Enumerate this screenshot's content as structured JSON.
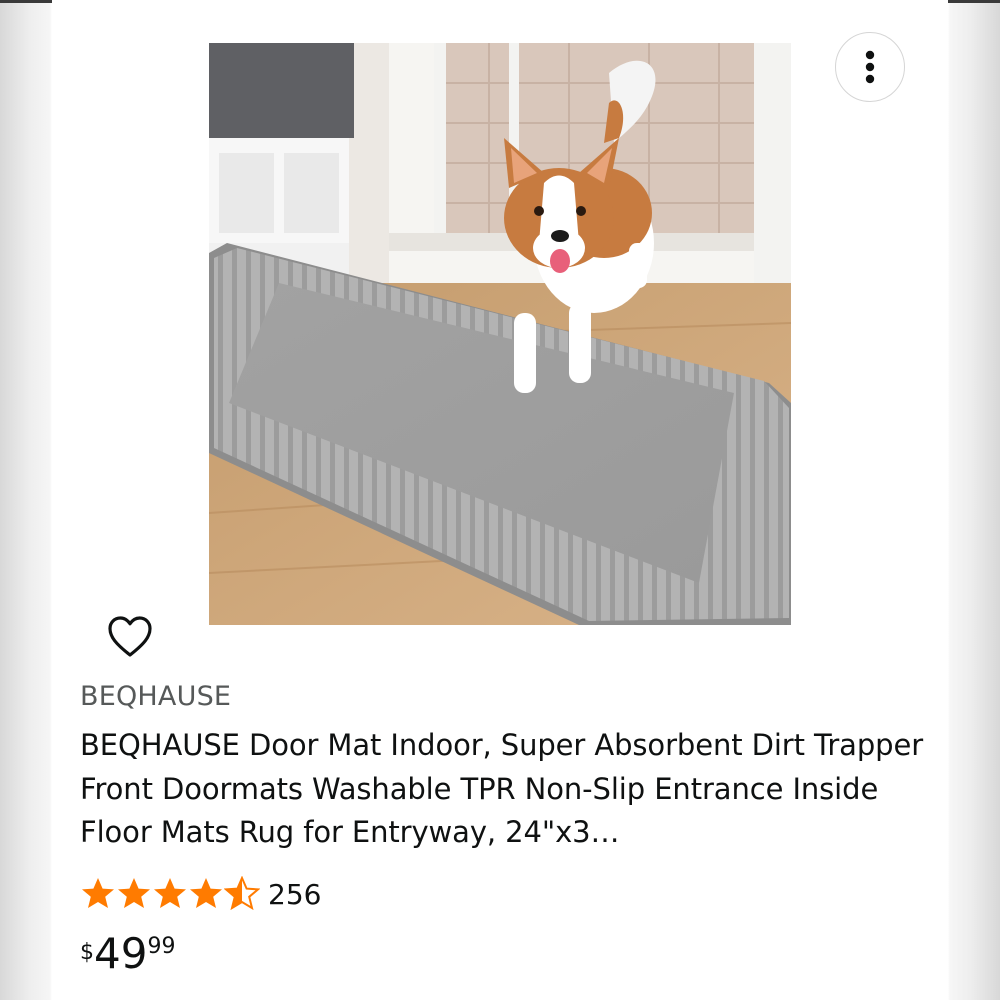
{
  "product": {
    "brand": "BEQHAUSE",
    "title": "BEQHAUSE Door Mat Indoor, Super Absorbent Dirt Trapper Front Doormats Washable TPR Non-Slip Entrance Inside Floor Mats Rug for Entryway, 24\"x3…",
    "rating": 4.5,
    "review_count": "256",
    "price": {
      "symbol": "$",
      "whole": "49",
      "fraction": "99"
    }
  },
  "icons": {
    "more": "more-vertical-icon",
    "wishlist": "heart-outline-icon",
    "star": "star-icon"
  },
  "colors": {
    "star": "#f3a847",
    "star_fill": "#ff9900",
    "text_primary": "#0f1111",
    "text_secondary": "#565959"
  }
}
